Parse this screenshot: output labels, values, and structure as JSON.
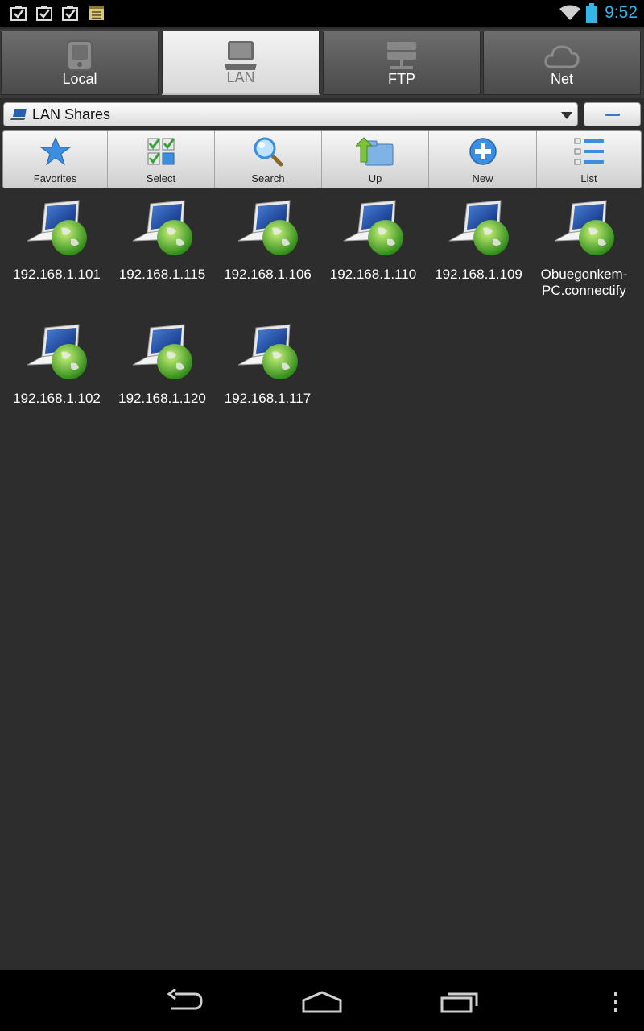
{
  "status_bar": {
    "time": "9:52",
    "notification_icons": [
      "task-check-icon",
      "task-check-icon",
      "task-check-icon",
      "notepad-icon"
    ],
    "system_icons": [
      "wifi-icon",
      "battery-icon"
    ],
    "accent_color": "#33b5e5"
  },
  "tabs": [
    {
      "label": "Local",
      "icon": "sd-card-icon",
      "active": false
    },
    {
      "label": "LAN",
      "icon": "laptop-icon",
      "active": true
    },
    {
      "label": "FTP",
      "icon": "server-icon",
      "active": false
    },
    {
      "label": "Net",
      "icon": "cloud-icon",
      "active": false
    }
  ],
  "path_bar": {
    "current": "LAN Shares",
    "icon": "laptop-icon"
  },
  "toolbar": [
    {
      "label": "Favorites",
      "icon": "star-icon"
    },
    {
      "label": "Select",
      "icon": "select-grid-icon"
    },
    {
      "label": "Search",
      "icon": "magnifier-icon"
    },
    {
      "label": "Up",
      "icon": "folder-up-icon"
    },
    {
      "label": "New",
      "icon": "plus-icon"
    },
    {
      "label": "List",
      "icon": "list-view-icon"
    }
  ],
  "shares": [
    {
      "label": "192.168.1.101"
    },
    {
      "label": "192.168.1.115"
    },
    {
      "label": "192.168.1.106"
    },
    {
      "label": "192.168.1.110"
    },
    {
      "label": "192.168.1.109"
    },
    {
      "label": "Obuegonkem-PC.connectify"
    },
    {
      "label": "192.168.1.102"
    },
    {
      "label": "192.168.1.120"
    },
    {
      "label": "192.168.1.117"
    }
  ],
  "nav_bar": [
    "back-icon",
    "home-icon",
    "recents-icon",
    "overflow-menu-icon"
  ]
}
